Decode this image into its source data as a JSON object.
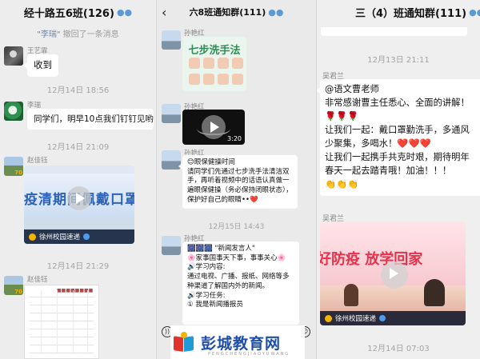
{
  "panels": [
    {
      "title": "经十路五6班(126)",
      "system_notice": {
        "quote": "\"李瑞\"",
        "text": " 撤回了一条消息"
      },
      "messages": [
        {
          "sender": "王艺霏",
          "text": "收到"
        },
        {
          "timestamp": "12月14日 18:56"
        },
        {
          "sender": "李瑞",
          "text": "同学们，明早10点我们钉钉见哟🌹"
        },
        {
          "timestamp": "12月14日 21:09"
        },
        {
          "sender": "赵佳钰",
          "video": {
            "banner": "疫清期间佩戴口罩",
            "footer": "徐州校园速递"
          }
        },
        {
          "timestamp": "12月14日 21:29"
        },
        {
          "sender": "赵佳钰",
          "image": "schedule-sheet"
        }
      ]
    },
    {
      "title": "六8班通知群(111)",
      "messages": [
        {
          "sender": "孙艳红",
          "image": {
            "title": "七步洗手法"
          }
        },
        {
          "sender": "孙艳红",
          "video": {
            "duration": "3:20"
          }
        },
        {
          "sender": "孙艳红",
          "text": "😊眼保健操时间\n请同学们先通过七步洗手法清洁双手，再听着视频中的话语认真做一遍眼保健操（务必保持闭眼状态），保护好自己的眼睛••❤️"
        },
        {
          "timestamp": "12月15日 14:43"
        },
        {
          "sender": "孙艳红",
          "text": "🎆🎆🎆 \"新闻发言人\"\n🌸家事国事天下事，事事关心🌸\n🔊学习内容:\n通过电视、广播、报纸、网络等多种渠道了解国内外的新闻。\n🔊学习任务:\n① 我是新闻播报员"
        }
      ],
      "toolbar": {
        "left": "voice-icon",
        "right": "emoji-icon"
      }
    },
    {
      "title": "三（4）班通知群(111)",
      "messages": [
        {
          "timestamp": "12月13日 21:11"
        },
        {
          "sender": "吴君兰",
          "text": "@语文曹老师\n非常感谢曹主任悉心、全面的讲解！🌹🌹🌹\n让我们一起：戴口罩勤洗手，多通风少聚集，多喝水！❤️❤️❤️\n让我们一起携手共克时艰，期待明年春天一起去踏青哦！加油！！！\n👏👏👏"
        },
        {
          "sender": "吴君兰",
          "video": {
            "banner": "好防疫 放学回家",
            "footer": "徐州校园速递"
          }
        },
        {
          "timestamp": "12月14日 07:03"
        }
      ]
    }
  ],
  "watermark": {
    "text": "彭城教育网",
    "sub": "PENGCHENGJIAOYUWANG"
  },
  "colors": {
    "chat_bg": "#ededed",
    "bubble": "#ffffff",
    "link_blue": "#2d63b6",
    "watermark_blue": "#1f4ea8"
  }
}
